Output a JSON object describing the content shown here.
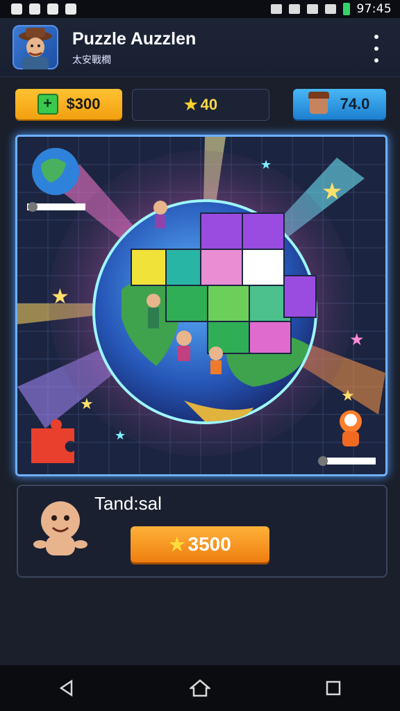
{
  "status_bar": {
    "time": "97:45"
  },
  "header": {
    "title": "Puzzle Auzzlen",
    "subtitle": "太安戰橺"
  },
  "currency": {
    "coins": "$300",
    "stars": "40",
    "tickets": "74.0"
  },
  "reward": {
    "label": "Tand:sal",
    "button_label": "3500"
  },
  "icons": {
    "app": "explorer-avatar-icon",
    "menu": "more-vert-icon",
    "coins": "plus-icon",
    "stars": "star-icon",
    "tickets": "avatar-icon",
    "board_piece": "puzzle-piece-icon",
    "nav": [
      "back-icon",
      "home-icon",
      "recents-icon"
    ]
  },
  "colors": {
    "coins": "#f2a00f",
    "tickets": "#1d7fd0",
    "board_border": "#6fb0ff",
    "claim": "#ee7e10"
  }
}
